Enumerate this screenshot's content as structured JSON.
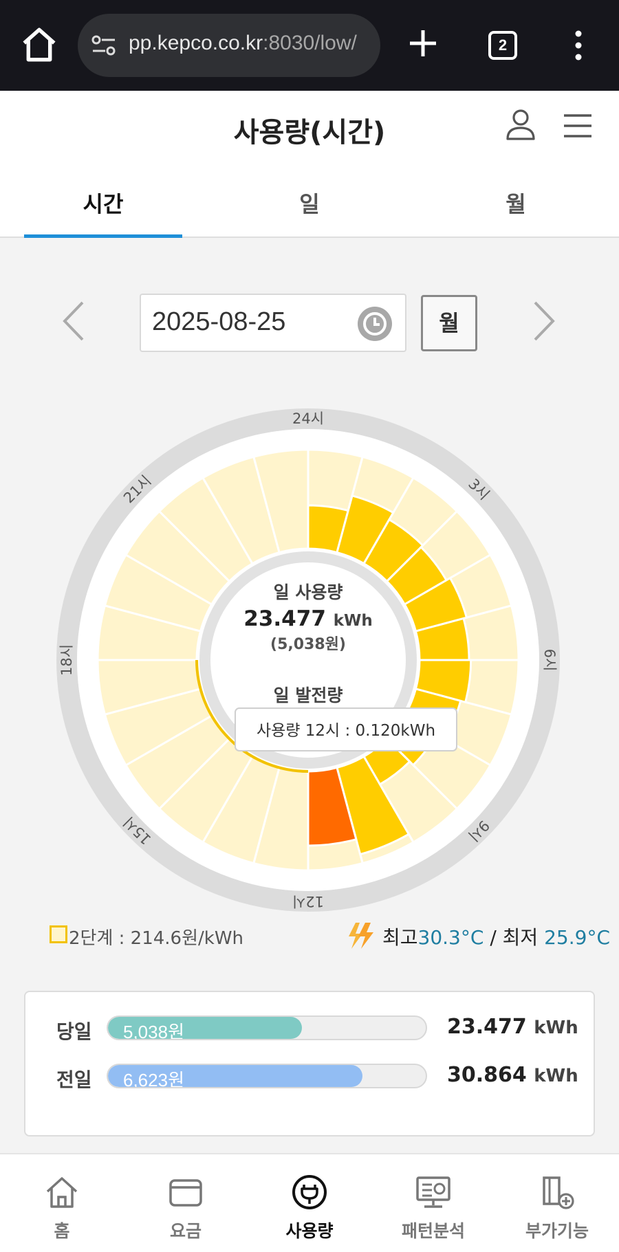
{
  "browser": {
    "url_main": "pp.kepco.co.kr",
    "url_rest": ":8030/low/",
    "tab_count": "2"
  },
  "header": {
    "title": "사용량(시간)",
    "tabs": [
      {
        "label": "시간",
        "active": true
      },
      {
        "label": "일",
        "active": false
      },
      {
        "label": "월",
        "active": false
      }
    ]
  },
  "date_selector": {
    "date": "2025-08-25",
    "month_button": "월"
  },
  "chart_data": {
    "type": "radial-bar",
    "hour_labels": [
      "24시",
      "3시",
      "6시",
      "9시",
      "12시",
      "15시",
      "18시",
      "21시"
    ],
    "values": [
      0.07,
      0.095,
      0.082,
      0.078,
      0.085,
      0.08,
      0.083,
      0.075,
      0.06,
      0.052,
      0.145,
      0.12,
      null,
      null,
      null,
      null,
      null,
      null,
      null,
      null,
      null,
      null,
      null,
      null
    ],
    "value_unit": "kWh",
    "max_value": 0.16,
    "highlight_hour": 11,
    "center": {
      "usage_label": "일 사용량",
      "usage_value": "23.477",
      "usage_unit": "kWh",
      "usage_cost": "(5,038원)",
      "gen_label": "일 발전량"
    },
    "tooltip": "사용량 12시 : 0.120kWh",
    "colors": {
      "bar": "#ffcd00",
      "highlight": "#ff6a00",
      "track": "#fff4cc",
      "ring": "#dcdcdc",
      "inner_ring": "#e2e2e2",
      "gen_arc": "#f2c200"
    }
  },
  "legend": {
    "tier": "2단계 : 214.6원/kWh",
    "temp_high_label": "최고",
    "temp_high": "30.3°C",
    "temp_sep": " / ",
    "temp_low_label": "최저",
    "temp_low": "25.9°C"
  },
  "compare": {
    "rows": [
      {
        "label": "당일",
        "cost": "5,038원",
        "value": "23.477",
        "unit": "kWh",
        "fraction": 0.61,
        "color": "#7fcac4"
      },
      {
        "label": "전일",
        "cost": "6,623원",
        "value": "30.864",
        "unit": "kWh",
        "fraction": 0.8,
        "color": "#92bdf3"
      }
    ]
  },
  "bottom_nav": [
    {
      "label": "홈",
      "active": false
    },
    {
      "label": "요금",
      "active": false
    },
    {
      "label": "사용량",
      "active": true
    },
    {
      "label": "패턴분석",
      "active": false
    },
    {
      "label": "부가기능",
      "active": false
    }
  ]
}
